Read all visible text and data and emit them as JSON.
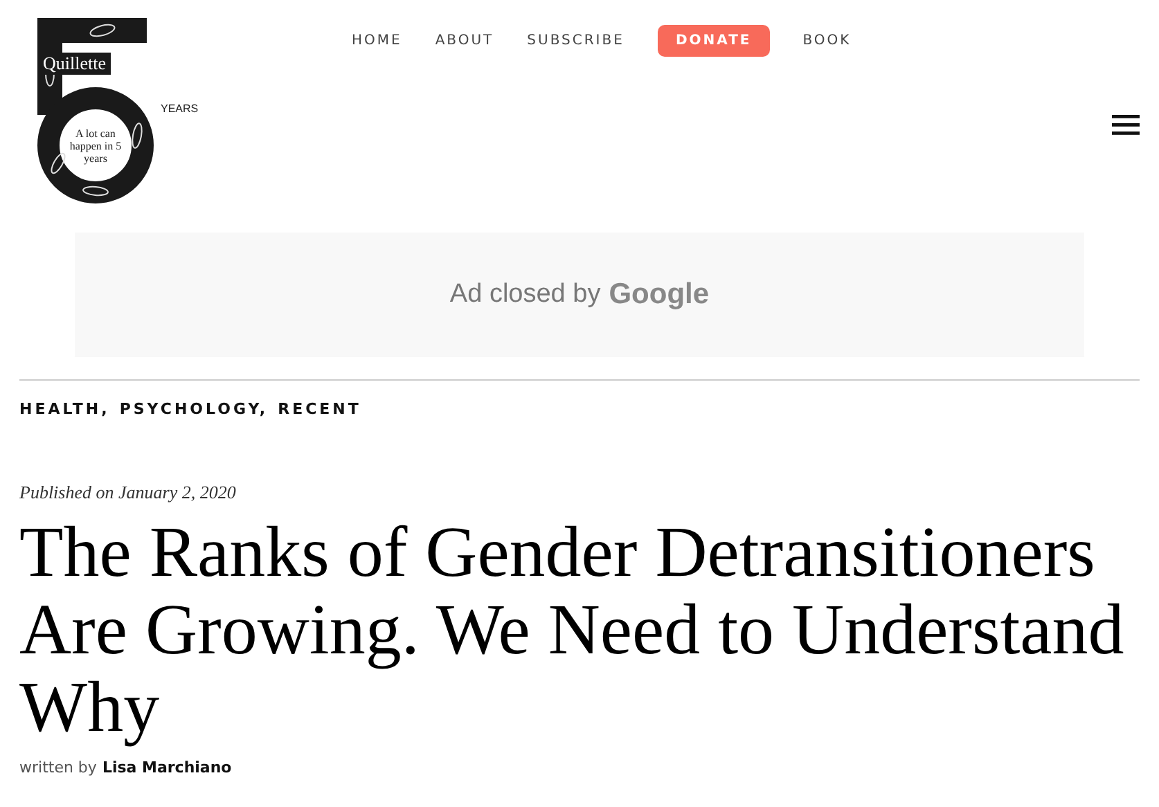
{
  "logo": {
    "name": "Quillette",
    "years": "YEARS",
    "tagline": "A lot can happen in 5 years"
  },
  "nav": [
    {
      "label": "HOME",
      "kind": "link"
    },
    {
      "label": "ABOUT",
      "kind": "link"
    },
    {
      "label": "SUBSCRIBE",
      "kind": "link"
    },
    {
      "label": "DONATE",
      "kind": "button"
    },
    {
      "label": "BOOK",
      "kind": "link"
    }
  ],
  "ad": {
    "text": "Ad closed by",
    "brand": "Google"
  },
  "categories": [
    "HEALTH,",
    "PSYCHOLOGY,",
    "RECENT"
  ],
  "published": "Published on January 2, 2020",
  "title": "The Ranks of Gender Detransitioners Are Growing. We Need to Understand Why",
  "byline": {
    "prefix": "written by",
    "author": "Lisa Marchiano"
  }
}
